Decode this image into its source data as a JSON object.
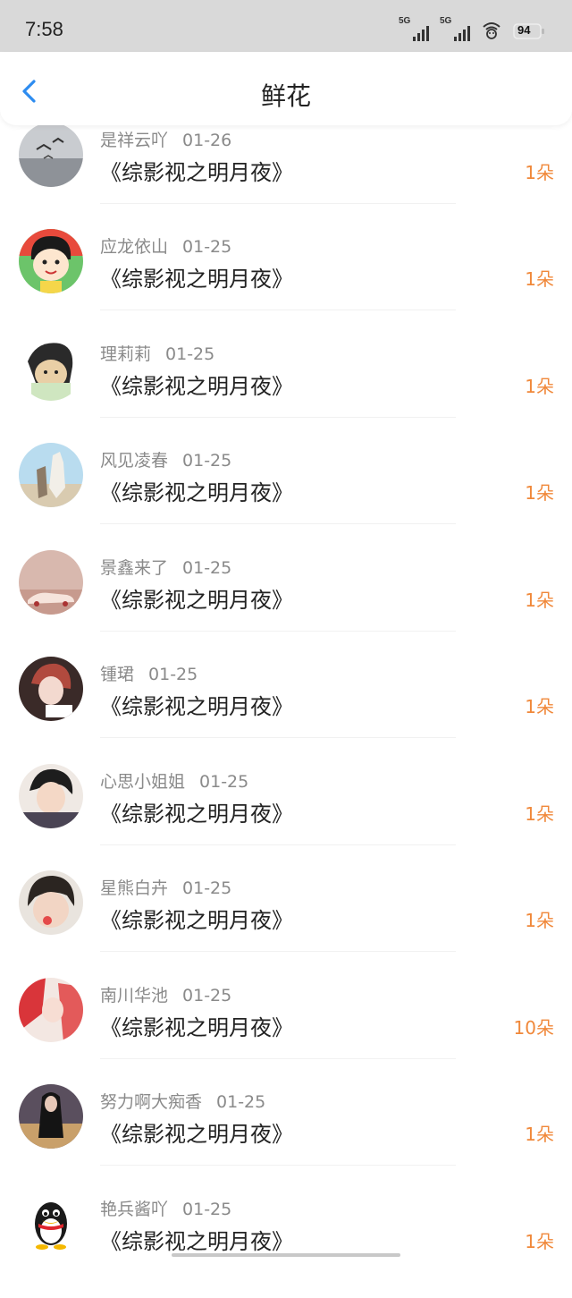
{
  "status_bar": {
    "time": "7:58",
    "network1": "5G",
    "network2": "5G",
    "battery": "94"
  },
  "nav": {
    "title": "鲜花"
  },
  "rows": [
    {
      "name": "是祥云吖",
      "date": "01-26",
      "title": "《综影视之明月夜》",
      "count": "1朵"
    },
    {
      "name": "应龙依山",
      "date": "01-25",
      "title": "《综影视之明月夜》",
      "count": "1朵"
    },
    {
      "name": "理莉莉",
      "date": "01-25",
      "title": "《综影视之明月夜》",
      "count": "1朵"
    },
    {
      "name": "风见凌春",
      "date": "01-25",
      "title": "《综影视之明月夜》",
      "count": "1朵"
    },
    {
      "name": "景鑫来了",
      "date": "01-25",
      "title": "《综影视之明月夜》",
      "count": "1朵"
    },
    {
      "name": "锺珺",
      "date": "01-25",
      "title": "《综影视之明月夜》",
      "count": "1朵"
    },
    {
      "name": "心思小姐姐",
      "date": "01-25",
      "title": "《综影视之明月夜》",
      "count": "1朵"
    },
    {
      "name": "星熊白卉",
      "date": "01-25",
      "title": "《综影视之明月夜》",
      "count": "1朵"
    },
    {
      "name": "南川华池",
      "date": "01-25",
      "title": "《综影视之明月夜》",
      "count": "10朵"
    },
    {
      "name": "努力啊大痴香",
      "date": "01-25",
      "title": "《综影视之明月夜》",
      "count": "1朵"
    },
    {
      "name": "艳兵酱吖",
      "date": "01-25",
      "title": "《综影视之明月夜》",
      "count": "1朵"
    }
  ],
  "colors": {
    "accent": "#2d8cf0",
    "count": "#f0883a",
    "status_bg": "#d9d9d9"
  }
}
